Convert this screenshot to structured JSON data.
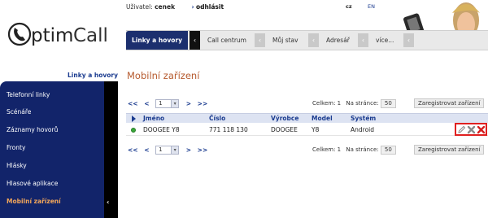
{
  "header": {
    "user_label": "Uživatel:",
    "user_name": "cenek",
    "logout_label": "odhlásit",
    "lang_cz": "cz",
    "lang_en": "EN",
    "logo_text": "OptimCall"
  },
  "tabs": [
    {
      "label": "Linky a hovory"
    },
    {
      "label": "Call centrum"
    },
    {
      "label": "Můj stav"
    },
    {
      "label": "Adresář"
    },
    {
      "label": "více..."
    }
  ],
  "sidebar": {
    "title": "Linky a hovory",
    "items": [
      {
        "label": "Telefonní linky"
      },
      {
        "label": "Scénáře"
      },
      {
        "label": "Záznamy hovorů"
      },
      {
        "label": "Fronty"
      },
      {
        "label": "Hlásky"
      },
      {
        "label": "Hlasové aplikace"
      },
      {
        "label": "Mobilní zařízení"
      }
    ]
  },
  "main": {
    "title": "Mobilní zařízení",
    "pager": {
      "first": "<<",
      "prev": "<",
      "next": ">",
      "last": ">>",
      "current_page": "1"
    },
    "totals_label": "Celkem:",
    "totals_value": "1",
    "per_page_label": "Na stránce:",
    "per_page_value": "50",
    "register_button": "Zaregistrovat zařízení",
    "table": {
      "columns": [
        "Jméno",
        "Číslo",
        "Výrobce",
        "Model",
        "Systém"
      ],
      "rows": [
        {
          "name": "DOOGEE Y8",
          "number": "771 118 130",
          "vendor": "DOOGEE",
          "model": "Y8",
          "system": "Android",
          "status": "online"
        }
      ]
    }
  },
  "colors": {
    "brand_navy": "#12246a",
    "title_orange": "#b65a2e",
    "active_item": "#f2a65a",
    "highlight_red": "#e02020"
  },
  "icons": [
    "back-chevron-icon",
    "sort-icon",
    "status-online-icon",
    "edit-icon",
    "disable-icon",
    "delete-icon",
    "phone-logo-icon"
  ]
}
